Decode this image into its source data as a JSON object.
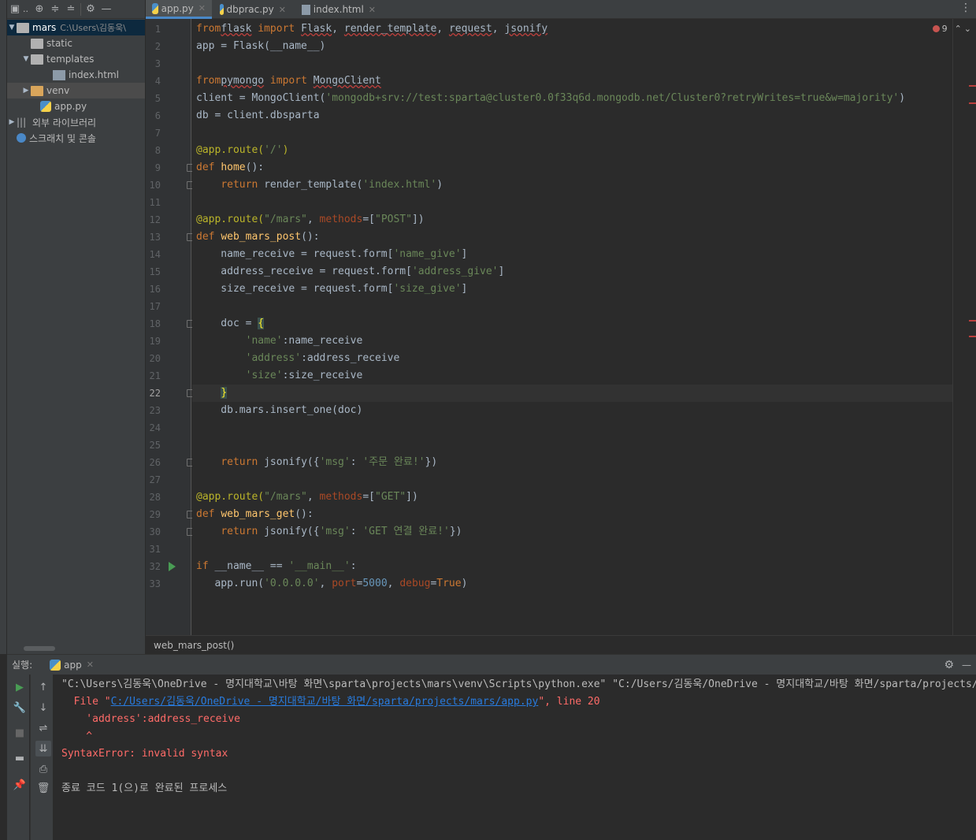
{
  "project": {
    "toolbar_title": "..",
    "tree": [
      {
        "label": "mars",
        "path": "C:\\Users\\김동욱\\"
      },
      {
        "label": "static"
      },
      {
        "label": "templates"
      },
      {
        "label": "index.html"
      },
      {
        "label": "venv"
      },
      {
        "label": "app.py"
      },
      {
        "label": "외부 라이브러리"
      },
      {
        "label": "스크래치 및 콘솔"
      }
    ]
  },
  "tabs": [
    {
      "label": "app.py"
    },
    {
      "label": "dbprac.py"
    },
    {
      "label": "index.html"
    }
  ],
  "editor": {
    "error_count": "9",
    "current_line": 22,
    "line_numbers": [
      "1",
      "2",
      "3",
      "4",
      "5",
      "6",
      "7",
      "8",
      "9",
      "10",
      "11",
      "12",
      "13",
      "14",
      "15",
      "16",
      "17",
      "18",
      "19",
      "20",
      "21",
      "22",
      "23",
      "24",
      "25",
      "26",
      "27",
      "28",
      "29",
      "30",
      "31",
      "32",
      "33"
    ],
    "lines": [
      [
        [
          "kw",
          "from"
        ],
        [
          "",
          "flask",
          "under"
        ],
        [
          "kw",
          " import "
        ],
        [
          "",
          "Flask",
          "under"
        ],
        [
          "",
          ", "
        ],
        [
          "",
          "render_template",
          "under"
        ],
        [
          "",
          ", "
        ],
        [
          "",
          "request",
          "under"
        ],
        [
          "",
          ", "
        ],
        [
          "",
          "jsonify",
          "under"
        ]
      ],
      [
        [
          "",
          "app = Flask(__name__)"
        ]
      ],
      [],
      [
        [
          "kw",
          "from"
        ],
        [
          "",
          "pymongo",
          "under"
        ],
        [
          "kw",
          " import "
        ],
        [
          "",
          "MongoClient",
          "under"
        ]
      ],
      [
        [
          "",
          "client = MongoClient("
        ],
        [
          "str",
          "'mongodb+srv://test:sparta@cluster0.0f33q6d.mongodb.net/Cluster0?retryWrites=true&w=majority'"
        ],
        [
          "",
          ")"
        ]
      ],
      [
        [
          "",
          "db = client.dbsparta"
        ]
      ],
      [],
      [
        [
          "deco",
          "@app.route("
        ],
        [
          "str",
          "'/'"
        ],
        [
          "deco",
          ")"
        ]
      ],
      [
        [
          "kw",
          "def "
        ],
        [
          "fn",
          "home"
        ],
        [
          "",
          "():"
        ]
      ],
      [
        [
          "",
          "    "
        ],
        [
          "kw",
          "return "
        ],
        [
          "",
          "render_template("
        ],
        [
          "str",
          "'index.html'"
        ],
        [
          "",
          ")"
        ]
      ],
      [],
      [
        [
          "deco",
          "@app.route("
        ],
        [
          "str",
          "\"/mars\""
        ],
        [
          "",
          ", "
        ],
        [
          "par",
          "methods"
        ],
        [
          "",
          "=["
        ],
        [
          "str",
          "\"POST\""
        ],
        [
          "",
          "])"
        ]
      ],
      [
        [
          "kw",
          "def "
        ],
        [
          "fn",
          "web_mars_post"
        ],
        [
          "",
          "():"
        ]
      ],
      [
        [
          "",
          "    name_receive = request.form["
        ],
        [
          "str",
          "'name_give'"
        ],
        [
          "",
          "]"
        ]
      ],
      [
        [
          "",
          "    address_receive = request.form["
        ],
        [
          "str",
          "'address_give'"
        ],
        [
          "",
          "]"
        ]
      ],
      [
        [
          "",
          "    size_receive = request.form["
        ],
        [
          "str",
          "'size_give'"
        ],
        [
          "",
          "]"
        ]
      ],
      [],
      [
        [
          "",
          "    doc = "
        ],
        [
          "brace",
          "{"
        ]
      ],
      [
        [
          "",
          "        "
        ],
        [
          "str",
          "'name'"
        ],
        [
          "",
          ":name_receive"
        ]
      ],
      [
        [
          "",
          "        "
        ],
        [
          "str",
          "'address'"
        ],
        [
          "",
          ":address_receive"
        ]
      ],
      [
        [
          "",
          "        "
        ],
        [
          "str",
          "'size'"
        ],
        [
          "",
          ":size_receive"
        ]
      ],
      [
        [
          "",
          "    "
        ],
        [
          "brace",
          "}"
        ]
      ],
      [
        [
          "",
          "    db.mars.insert_one(doc)"
        ]
      ],
      [],
      [],
      [
        [
          "",
          "    "
        ],
        [
          "kw",
          "return "
        ],
        [
          "",
          "jsonify({"
        ],
        [
          "str",
          "'msg'"
        ],
        [
          "",
          ": "
        ],
        [
          "str",
          "'주문 완료!'"
        ],
        [
          "",
          "})"
        ]
      ],
      [],
      [
        [
          "deco",
          "@app.route("
        ],
        [
          "str",
          "\"/mars\""
        ],
        [
          "",
          ", "
        ],
        [
          "par",
          "methods"
        ],
        [
          "",
          "=["
        ],
        [
          "str",
          "\"GET\""
        ],
        [
          "",
          "])"
        ]
      ],
      [
        [
          "kw",
          "def "
        ],
        [
          "fn",
          "web_mars_get"
        ],
        [
          "",
          "():"
        ]
      ],
      [
        [
          "",
          "    "
        ],
        [
          "kw",
          "return "
        ],
        [
          "",
          "jsonify({"
        ],
        [
          "str",
          "'msg'"
        ],
        [
          "",
          ": "
        ],
        [
          "str",
          "'GET 연결 완료!'"
        ],
        [
          "",
          "})"
        ]
      ],
      [],
      [
        [
          "kw",
          "if "
        ],
        [
          "",
          "__name__ == "
        ],
        [
          "str",
          "'__main__'"
        ],
        [
          "",
          ":"
        ]
      ],
      [
        [
          "",
          "   app.run("
        ],
        [
          "str",
          "'0.0.0.0'"
        ],
        [
          "",
          ", "
        ],
        [
          "par",
          "port"
        ],
        [
          "",
          "="
        ],
        [
          "num",
          "5000"
        ],
        [
          "",
          ", "
        ],
        [
          "par",
          "debug"
        ],
        [
          "",
          "="
        ],
        [
          "kw",
          "True"
        ],
        [
          "",
          ")"
        ]
      ]
    ]
  },
  "breadcrumb": "web_mars_post()",
  "run": {
    "label": "실행:",
    "config_name": "app",
    "console_lines": [
      {
        "type": "normal",
        "text": "\"C:\\Users\\김동욱\\OneDrive - 명지대학교\\바탕 화면\\sparta\\projects\\mars\\venv\\Scripts\\python.exe\" \"C:/Users/김동욱/OneDrive - 명지대학교/바탕 화면/sparta/projects/mars/app.py\""
      },
      {
        "type": "file",
        "prefix": "  File \"",
        "link": "C:/Users/김동욱/OneDrive - 명지대학교/바탕 화면/sparta/projects/mars/app.py",
        "suffix": "\", line 20"
      },
      {
        "type": "err",
        "text": "    'address':address_receive"
      },
      {
        "type": "err",
        "text": "    ^"
      },
      {
        "type": "err",
        "text": "SyntaxError: invalid syntax"
      },
      {
        "type": "normal",
        "text": ""
      },
      {
        "type": "normal",
        "text": "종료 코드 1(으)로 완료된 프로세스"
      }
    ]
  }
}
